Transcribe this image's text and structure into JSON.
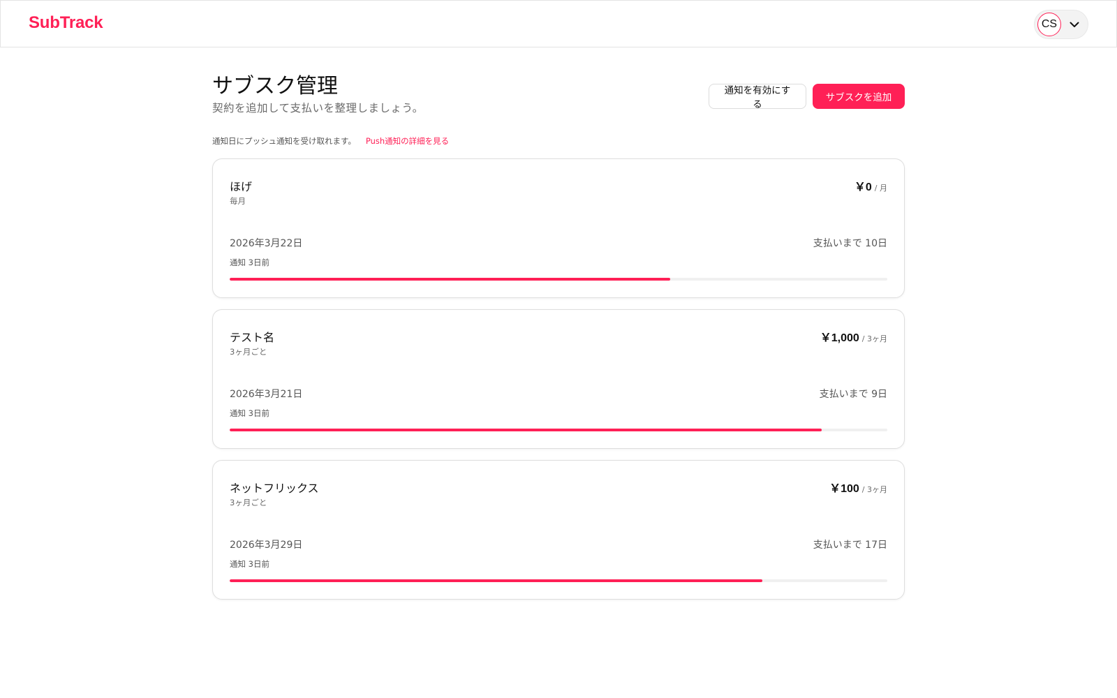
{
  "header": {
    "brand": "SubTrack",
    "user_initials": "CS"
  },
  "page": {
    "title": "サブスク管理",
    "subtitle": "契約を追加して支払いを整理しましょう。",
    "enable_notifications_label": "通知を有効にする",
    "add_subscription_label": "サブスクを追加",
    "push_notice_text": "通知日にプッシュ通知を受け取れます。",
    "push_notice_link": "Push通知の詳細を見る"
  },
  "subscriptions": [
    {
      "name": "ほげ",
      "cycle": "毎月",
      "price": "￥0",
      "price_unit": "/ 月",
      "next_date": "2026年3月22日",
      "remaining": "支払いまで 10日",
      "notify": "通知 3日前",
      "progress": 0.67
    },
    {
      "name": "テスト名",
      "cycle": "3ヶ月ごと",
      "price": "￥1,000",
      "price_unit": "/ 3ヶ月",
      "next_date": "2026年3月21日",
      "remaining": "支払いまで 9日",
      "notify": "通知 3日前",
      "progress": 0.9
    },
    {
      "name": "ネットフリックス",
      "cycle": "3ヶ月ごと",
      "price": "￥100",
      "price_unit": "/ 3ヶ月",
      "next_date": "2026年3月29日",
      "remaining": "支払いまで 17日",
      "notify": "通知 3日前",
      "progress": 0.81
    }
  ],
  "colors": {
    "accent": "#ff2056",
    "track": "#f0f0f0",
    "muted_text": "#6b6b6b"
  },
  "icons": {
    "user_menu": "chevron-down-icon"
  }
}
